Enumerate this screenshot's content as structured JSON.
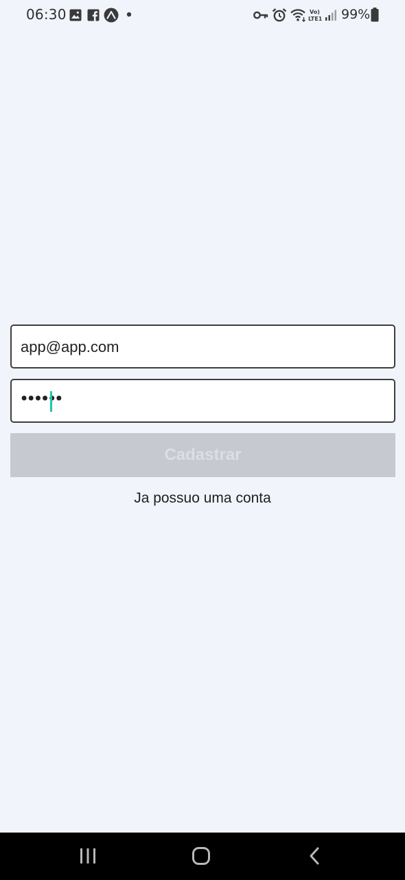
{
  "status_bar": {
    "time": "06:30",
    "battery_percent": "99%",
    "left_icons": [
      "gallery-notification-icon",
      "facebook-notification-icon",
      "expo-notification-icon",
      "more-notifications-dot-icon"
    ],
    "right_icons": [
      "vpn-key-icon",
      "alarm-icon",
      "wifi-icon",
      "volte-lte-icon",
      "cell-signal-icon",
      "battery-icon"
    ],
    "volte_label": "Vo) LTE1",
    "battery_level": 0.99
  },
  "form": {
    "email": {
      "value": "app@app.com"
    },
    "password": {
      "masked_value": "••••••",
      "cursor_color": "#1ec6b1"
    },
    "submit_label": "Cadastrar",
    "submit_state": "disabled",
    "login_link": "Ja possuo uma conta"
  },
  "nav_bar": {
    "buttons": [
      "recent-apps-icon",
      "home-icon",
      "back-icon"
    ]
  },
  "colors": {
    "background": "#f1f4fb",
    "field_border": "#3d3d3d",
    "button_disabled_bg": "#c6c9cf",
    "button_disabled_text": "#dcdee2",
    "cursor": "#1ec6b1",
    "nav_bar": "#000000"
  }
}
